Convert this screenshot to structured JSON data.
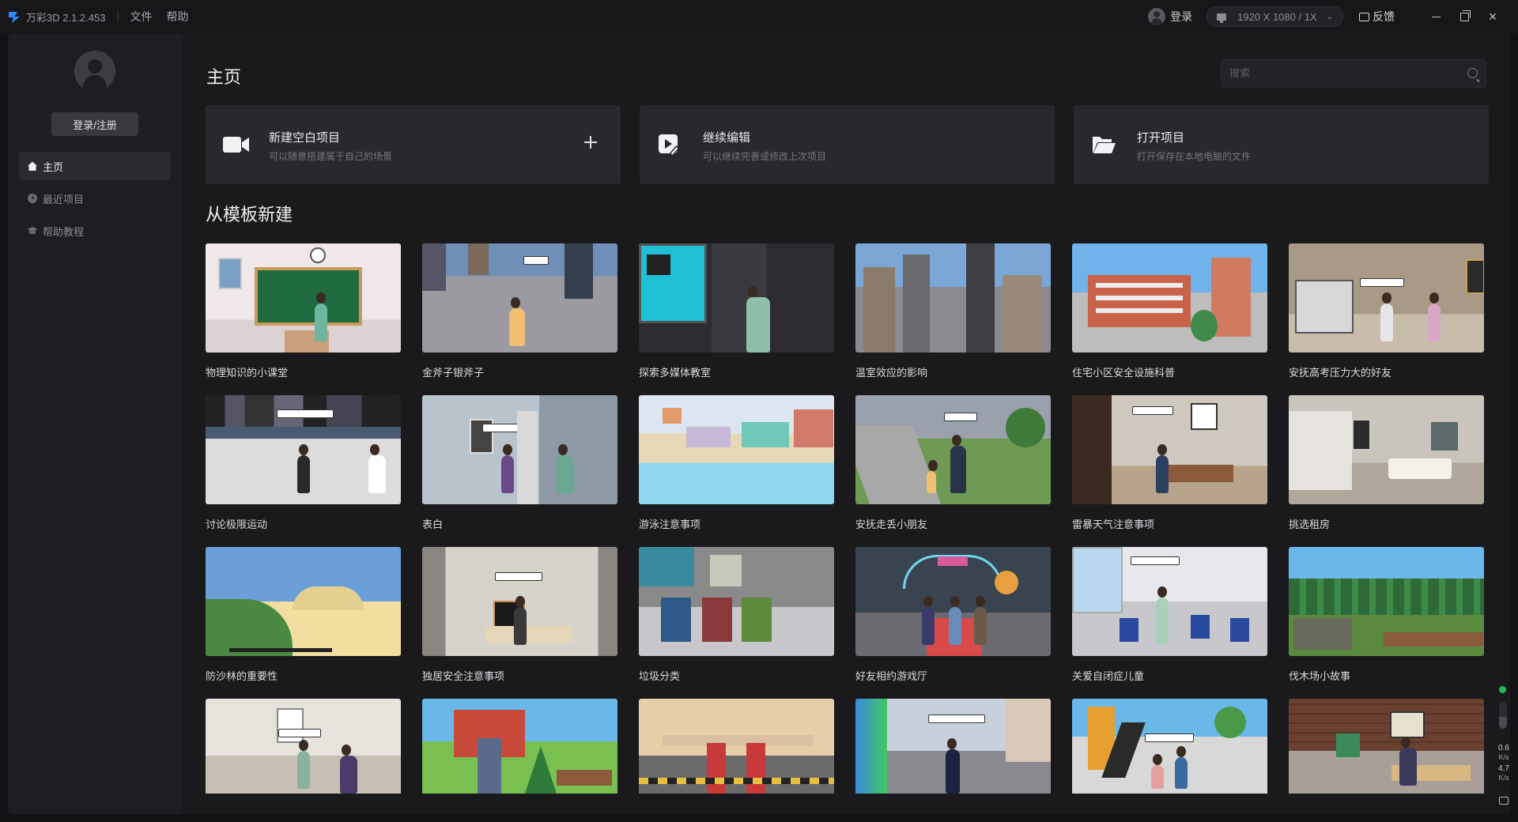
{
  "app": {
    "name": "万彩3D 2.1.2.453"
  },
  "menu": [
    {
      "label": "文件"
    },
    {
      "label": "帮助"
    }
  ],
  "titlebar": {
    "login_label": "登录",
    "resolution": "1920 X 1080 / 1X",
    "feedback_label": "反馈"
  },
  "sidebar": {
    "register_label": "登录/注册",
    "nav": [
      {
        "label": "主页",
        "icon": "home-icon",
        "active": true
      },
      {
        "label": "最近项目",
        "icon": "clock-icon",
        "active": false
      },
      {
        "label": "帮助教程",
        "icon": "graduation-cap-icon",
        "active": false
      }
    ]
  },
  "main": {
    "title": "主页",
    "search": {
      "placeholder": "搜索"
    },
    "actions": [
      {
        "title": "新建空白项目",
        "desc": "可以随意搭建属于自己的场景",
        "icon": "video-camera-icon"
      },
      {
        "title": "继续编辑",
        "desc": "可以继续完善或修改上次项目",
        "icon": "edit-video-icon"
      },
      {
        "title": "打开项目",
        "desc": "打开保存在本地电脑的文件",
        "icon": "folder-open-icon"
      }
    ],
    "templates_title": "从模板新建",
    "templates": [
      {
        "label": "物理知识的小课堂"
      },
      {
        "label": "金斧子银斧子"
      },
      {
        "label": "探索多媒体教室"
      },
      {
        "label": "温室效应的影响"
      },
      {
        "label": "住宅小区安全设施科普"
      },
      {
        "label": "安抚高考压力大的好友"
      },
      {
        "label": "讨论极限运动"
      },
      {
        "label": "表白"
      },
      {
        "label": "游泳注意事项"
      },
      {
        "label": "安抚走丢小朋友"
      },
      {
        "label": "雷暴天气注意事项"
      },
      {
        "label": "挑选租房"
      },
      {
        "label": "防沙林的重要性"
      },
      {
        "label": "独居安全注意事项"
      },
      {
        "label": "垃圾分类"
      },
      {
        "label": "好友相约游戏厅"
      },
      {
        "label": "关爱自闭症儿童"
      },
      {
        "label": "伐木场小故事"
      },
      {
        "label": ""
      },
      {
        "label": ""
      },
      {
        "label": ""
      },
      {
        "label": ""
      },
      {
        "label": ""
      },
      {
        "label": ""
      }
    ]
  },
  "status": {
    "upload_value": "0.6",
    "upload_unit": "K/s",
    "download_value": "4.7",
    "download_unit": "K/s",
    "indicator_color": "#1dbb55"
  }
}
